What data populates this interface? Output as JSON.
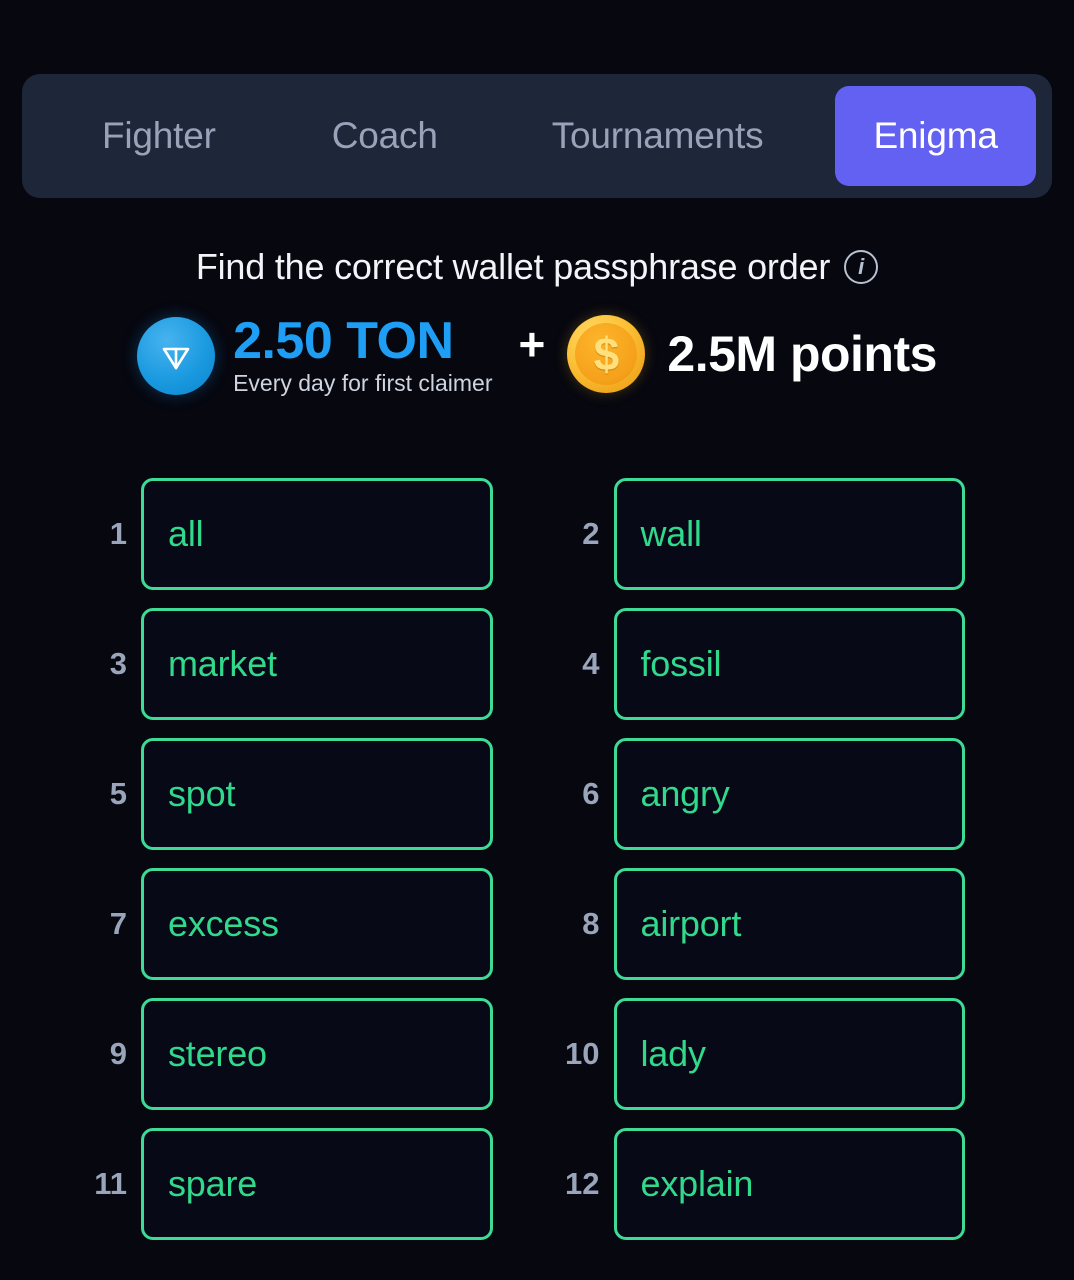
{
  "tabs": [
    {
      "label": "Fighter",
      "active": false
    },
    {
      "label": "Coach",
      "active": false
    },
    {
      "label": "Tournaments",
      "active": false
    },
    {
      "label": "Enigma",
      "active": true
    }
  ],
  "header": {
    "title": "Find the correct wallet passphrase order",
    "info_icon": "info-icon"
  },
  "reward": {
    "ton_icon": "ton-logo-icon",
    "ton_amount": "2.50 TON",
    "ton_subtext": "Every day for first claimer",
    "plus": "+",
    "coin_icon": "coin-icon",
    "coin_symbol": "$",
    "points": "2.5M points"
  },
  "colors": {
    "page_background": "#06070f",
    "tabbar_background": "#1e2739",
    "tab_active_background": "#6361f2",
    "tab_inactive_text": "#98a2b8",
    "word_green": "#31d98d",
    "border_green": "#3ddb96",
    "ton_blue": "#1e9ff5",
    "coin_gold": "#f5a01a",
    "index_gray": "#9aa5bb"
  },
  "passphrase": {
    "cells": [
      {
        "index": "1",
        "word": "all"
      },
      {
        "index": "2",
        "word": "wall"
      },
      {
        "index": "3",
        "word": "market"
      },
      {
        "index": "4",
        "word": "fossil"
      },
      {
        "index": "5",
        "word": "spot"
      },
      {
        "index": "6",
        "word": "angry"
      },
      {
        "index": "7",
        "word": "excess"
      },
      {
        "index": "8",
        "word": "airport"
      },
      {
        "index": "9",
        "word": "stereo"
      },
      {
        "index": "10",
        "word": "lady"
      },
      {
        "index": "11",
        "word": "spare"
      },
      {
        "index": "12",
        "word": "explain"
      }
    ]
  }
}
